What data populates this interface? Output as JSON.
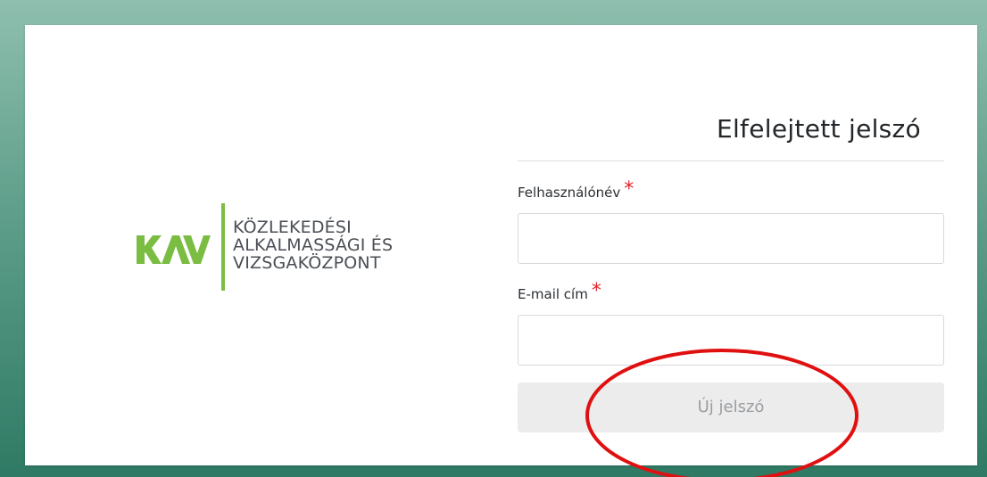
{
  "logo": {
    "mark_text": "KAV",
    "lines": [
      "KÖZLEKEDÉSI",
      "ALKALMASSÁGI ÉS",
      "VIZSGAKÖZPONT"
    ],
    "brand_color": "#7bbd43"
  },
  "form": {
    "title": "Elfelejtett jelszó",
    "fields": [
      {
        "label": "Felhasználónév",
        "required_mark": "*",
        "value": "",
        "placeholder": ""
      },
      {
        "label": "E-mail cím",
        "required_mark": "*",
        "value": "",
        "placeholder": ""
      }
    ],
    "submit_label": "Új jelszó",
    "submit_enabled": false
  },
  "colors": {
    "required": "#e0262b",
    "annotation": "#e01010",
    "background_top": "#8fbfae",
    "background_bottom": "#2f7a64"
  }
}
